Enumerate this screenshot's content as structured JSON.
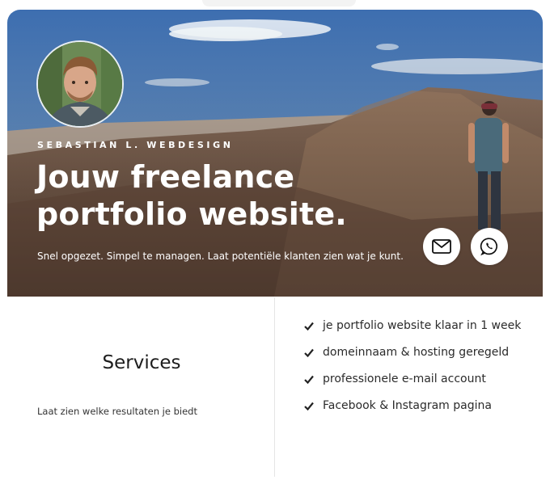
{
  "hero": {
    "brand": "SEBASTIAN L. WEBDESIGN",
    "headline": "Jouw freelance portfolio website.",
    "tagline": "Snel opgezet. Simpel te managen. Laat potentiële klanten zien wat je kunt.",
    "buttons": [
      {
        "icon": "envelope-icon"
      },
      {
        "icon": "whatsapp-icon"
      }
    ]
  },
  "services": {
    "title": "Services",
    "subtitle": "Laat zien welke resultaten je biedt"
  },
  "features": [
    "je portfolio website klaar in 1 week",
    "domeinnaam & hosting geregeld",
    "professionele e-mail account",
    "Facebook & Instagram pagina"
  ],
  "colors": {
    "text_dark": "#1d1d1d",
    "white": "#ffffff",
    "sky": "#4a7ab8"
  }
}
